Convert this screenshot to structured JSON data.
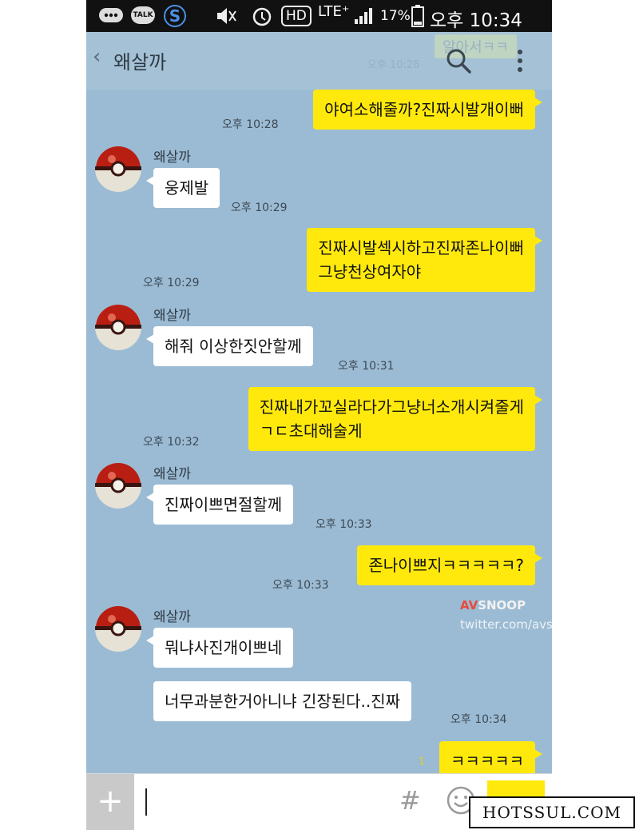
{
  "status_bar": {
    "battery": "17%",
    "time": "오후 10:34",
    "lte_label": "LTE⁺",
    "hd_label": "HD",
    "talk_badge": "TALK"
  },
  "header": {
    "title": "왜살까",
    "ghost_text": "알아서ㅋㅋ",
    "ghost_time": "오후 10:28"
  },
  "messages": [
    {
      "from": "me",
      "lines": [
        "야여소해줄까?진짜시발개이뻐"
      ],
      "time": "오후 10:28"
    },
    {
      "from": "other",
      "sender": "왜살까",
      "lines": [
        "웅제발"
      ],
      "time": "오후 10:29"
    },
    {
      "from": "me",
      "lines": [
        "진짜시발섹시하고진짜존나이뻐",
        "그냥천상여자야"
      ],
      "time": "오후 10:29"
    },
    {
      "from": "other",
      "sender": "왜살까",
      "lines": [
        "해줘 이상한짓안할께"
      ],
      "time": "오후 10:31"
    },
    {
      "from": "me",
      "lines": [
        "진짜내가꼬실라다가그냥너소개시켜줄게",
        "ㄱㄷ초대해술게"
      ],
      "time": "오후 10:32"
    },
    {
      "from": "other",
      "sender": "왜살까",
      "lines": [
        "진짜이쁘면절할께"
      ],
      "time": "오후 10:33"
    },
    {
      "from": "me",
      "lines": [
        "존나이쁘지ㅋㅋㅋㅋㅋ?"
      ],
      "time": "오후 10:33"
    },
    {
      "from": "other",
      "sender": "왜살까",
      "lines": [
        "뭐냐사진개이쁘네"
      ],
      "time": ""
    },
    {
      "from": "other",
      "lines": [
        "너무과분한거아니냐 긴장된다..진짜"
      ],
      "time": "오후 10:34"
    },
    {
      "from": "me",
      "lines": [
        "ㅋㅋㅋㅋㅋ"
      ],
      "unread": "1"
    }
  ],
  "watermark": {
    "logo_a": "AV",
    "logo_b": "SNOOP",
    "url": "twitter.com/avsnoop"
  },
  "input_bar": {
    "plus": "+",
    "hash": "#"
  },
  "brand": "HOTSSUL.COM",
  "colors": {
    "chat_bg": "#9bbbd4",
    "my_bubble": "#ffe90c",
    "other_bubble": "#ffffff",
    "logo_red": "#e84b3a"
  },
  "icons": [
    "message-icon",
    "talk-icon",
    "s-icon",
    "mute-icon",
    "alarm-icon",
    "signal-icon",
    "battery-icon",
    "back-icon",
    "search-icon",
    "more-icon",
    "pokeball-avatar",
    "plus-icon",
    "hash-icon",
    "emoji-icon"
  ]
}
